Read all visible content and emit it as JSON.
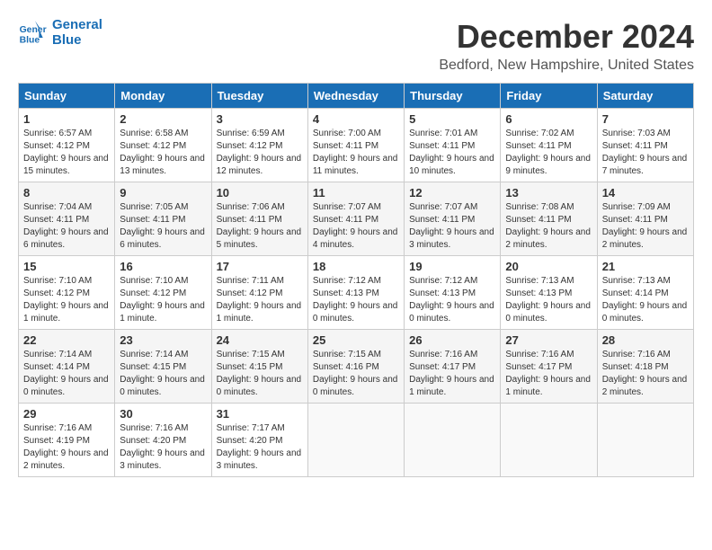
{
  "header": {
    "logo_line1": "General",
    "logo_line2": "Blue",
    "month": "December 2024",
    "location": "Bedford, New Hampshire, United States"
  },
  "weekdays": [
    "Sunday",
    "Monday",
    "Tuesday",
    "Wednesday",
    "Thursday",
    "Friday",
    "Saturday"
  ],
  "weeks": [
    [
      {
        "day": "1",
        "sunrise": "Sunrise: 6:57 AM",
        "sunset": "Sunset: 4:12 PM",
        "daylight": "Daylight: 9 hours and 15 minutes."
      },
      {
        "day": "2",
        "sunrise": "Sunrise: 6:58 AM",
        "sunset": "Sunset: 4:12 PM",
        "daylight": "Daylight: 9 hours and 13 minutes."
      },
      {
        "day": "3",
        "sunrise": "Sunrise: 6:59 AM",
        "sunset": "Sunset: 4:12 PM",
        "daylight": "Daylight: 9 hours and 12 minutes."
      },
      {
        "day": "4",
        "sunrise": "Sunrise: 7:00 AM",
        "sunset": "Sunset: 4:11 PM",
        "daylight": "Daylight: 9 hours and 11 minutes."
      },
      {
        "day": "5",
        "sunrise": "Sunrise: 7:01 AM",
        "sunset": "Sunset: 4:11 PM",
        "daylight": "Daylight: 9 hours and 10 minutes."
      },
      {
        "day": "6",
        "sunrise": "Sunrise: 7:02 AM",
        "sunset": "Sunset: 4:11 PM",
        "daylight": "Daylight: 9 hours and 9 minutes."
      },
      {
        "day": "7",
        "sunrise": "Sunrise: 7:03 AM",
        "sunset": "Sunset: 4:11 PM",
        "daylight": "Daylight: 9 hours and 7 minutes."
      }
    ],
    [
      {
        "day": "8",
        "sunrise": "Sunrise: 7:04 AM",
        "sunset": "Sunset: 4:11 PM",
        "daylight": "Daylight: 9 hours and 6 minutes."
      },
      {
        "day": "9",
        "sunrise": "Sunrise: 7:05 AM",
        "sunset": "Sunset: 4:11 PM",
        "daylight": "Daylight: 9 hours and 6 minutes."
      },
      {
        "day": "10",
        "sunrise": "Sunrise: 7:06 AM",
        "sunset": "Sunset: 4:11 PM",
        "daylight": "Daylight: 9 hours and 5 minutes."
      },
      {
        "day": "11",
        "sunrise": "Sunrise: 7:07 AM",
        "sunset": "Sunset: 4:11 PM",
        "daylight": "Daylight: 9 hours and 4 minutes."
      },
      {
        "day": "12",
        "sunrise": "Sunrise: 7:07 AM",
        "sunset": "Sunset: 4:11 PM",
        "daylight": "Daylight: 9 hours and 3 minutes."
      },
      {
        "day": "13",
        "sunrise": "Sunrise: 7:08 AM",
        "sunset": "Sunset: 4:11 PM",
        "daylight": "Daylight: 9 hours and 2 minutes."
      },
      {
        "day": "14",
        "sunrise": "Sunrise: 7:09 AM",
        "sunset": "Sunset: 4:11 PM",
        "daylight": "Daylight: 9 hours and 2 minutes."
      }
    ],
    [
      {
        "day": "15",
        "sunrise": "Sunrise: 7:10 AM",
        "sunset": "Sunset: 4:12 PM",
        "daylight": "Daylight: 9 hours and 1 minute."
      },
      {
        "day": "16",
        "sunrise": "Sunrise: 7:10 AM",
        "sunset": "Sunset: 4:12 PM",
        "daylight": "Daylight: 9 hours and 1 minute."
      },
      {
        "day": "17",
        "sunrise": "Sunrise: 7:11 AM",
        "sunset": "Sunset: 4:12 PM",
        "daylight": "Daylight: 9 hours and 1 minute."
      },
      {
        "day": "18",
        "sunrise": "Sunrise: 7:12 AM",
        "sunset": "Sunset: 4:13 PM",
        "daylight": "Daylight: 9 hours and 0 minutes."
      },
      {
        "day": "19",
        "sunrise": "Sunrise: 7:12 AM",
        "sunset": "Sunset: 4:13 PM",
        "daylight": "Daylight: 9 hours and 0 minutes."
      },
      {
        "day": "20",
        "sunrise": "Sunrise: 7:13 AM",
        "sunset": "Sunset: 4:13 PM",
        "daylight": "Daylight: 9 hours and 0 minutes."
      },
      {
        "day": "21",
        "sunrise": "Sunrise: 7:13 AM",
        "sunset": "Sunset: 4:14 PM",
        "daylight": "Daylight: 9 hours and 0 minutes."
      }
    ],
    [
      {
        "day": "22",
        "sunrise": "Sunrise: 7:14 AM",
        "sunset": "Sunset: 4:14 PM",
        "daylight": "Daylight: 9 hours and 0 minutes."
      },
      {
        "day": "23",
        "sunrise": "Sunrise: 7:14 AM",
        "sunset": "Sunset: 4:15 PM",
        "daylight": "Daylight: 9 hours and 0 minutes."
      },
      {
        "day": "24",
        "sunrise": "Sunrise: 7:15 AM",
        "sunset": "Sunset: 4:15 PM",
        "daylight": "Daylight: 9 hours and 0 minutes."
      },
      {
        "day": "25",
        "sunrise": "Sunrise: 7:15 AM",
        "sunset": "Sunset: 4:16 PM",
        "daylight": "Daylight: 9 hours and 0 minutes."
      },
      {
        "day": "26",
        "sunrise": "Sunrise: 7:16 AM",
        "sunset": "Sunset: 4:17 PM",
        "daylight": "Daylight: 9 hours and 1 minute."
      },
      {
        "day": "27",
        "sunrise": "Sunrise: 7:16 AM",
        "sunset": "Sunset: 4:17 PM",
        "daylight": "Daylight: 9 hours and 1 minute."
      },
      {
        "day": "28",
        "sunrise": "Sunrise: 7:16 AM",
        "sunset": "Sunset: 4:18 PM",
        "daylight": "Daylight: 9 hours and 2 minutes."
      }
    ],
    [
      {
        "day": "29",
        "sunrise": "Sunrise: 7:16 AM",
        "sunset": "Sunset: 4:19 PM",
        "daylight": "Daylight: 9 hours and 2 minutes."
      },
      {
        "day": "30",
        "sunrise": "Sunrise: 7:16 AM",
        "sunset": "Sunset: 4:20 PM",
        "daylight": "Daylight: 9 hours and 3 minutes."
      },
      {
        "day": "31",
        "sunrise": "Sunrise: 7:17 AM",
        "sunset": "Sunset: 4:20 PM",
        "daylight": "Daylight: 9 hours and 3 minutes."
      },
      null,
      null,
      null,
      null
    ]
  ]
}
